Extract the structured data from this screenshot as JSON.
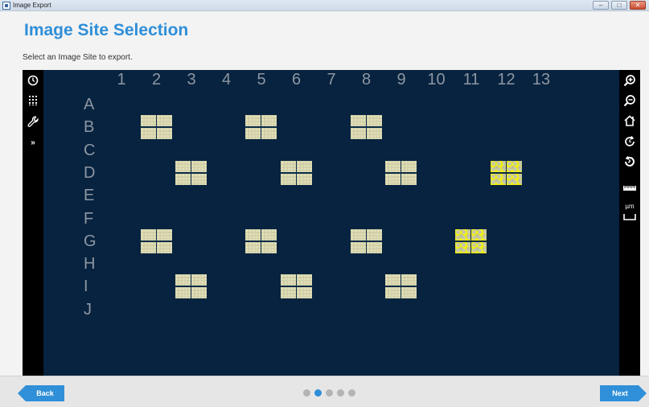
{
  "window": {
    "title": "Image Export",
    "controls": {
      "minimize": "–",
      "restore": "□",
      "close": "✕"
    }
  },
  "header": {
    "title": "Image Site Selection",
    "instruction": "Select an Image Site to export."
  },
  "grid": {
    "columns": [
      "1",
      "2",
      "3",
      "4",
      "5",
      "6",
      "7",
      "8",
      "9",
      "10",
      "11",
      "12",
      "13"
    ],
    "rows": [
      "A",
      "B",
      "C",
      "D",
      "E",
      "F",
      "G",
      "H",
      "I",
      "J"
    ],
    "sites": [
      {
        "well": "B2",
        "selected": false
      },
      {
        "well": "B5",
        "selected": false
      },
      {
        "well": "B8",
        "selected": false
      },
      {
        "well": "D3",
        "selected": false
      },
      {
        "well": "D6",
        "selected": false
      },
      {
        "well": "D9",
        "selected": false
      },
      {
        "well": "D12",
        "selected": true
      },
      {
        "well": "G2",
        "selected": false
      },
      {
        "well": "G5",
        "selected": false
      },
      {
        "well": "G8",
        "selected": false
      },
      {
        "well": "G11",
        "selected": true
      },
      {
        "well": "I3",
        "selected": false
      },
      {
        "well": "I6",
        "selected": false
      },
      {
        "well": "I9",
        "selected": false
      }
    ]
  },
  "left_toolbar": [
    "clock-icon",
    "column-grid-icon",
    "wrench-icon",
    "double-chevron-right-icon"
  ],
  "right_toolbar": [
    "zoom-in-icon",
    "zoom-out-icon",
    "home-icon",
    "rotate-clockwise-icon",
    "rotate-counterclockwise-icon",
    "ruler-icon",
    "scale-bar-icon"
  ],
  "right_toolbar_labels": {
    "scale_unit": "µm"
  },
  "navigation": {
    "back_label": "Back",
    "next_label": "Next",
    "page_count": 5,
    "current_page": 2
  },
  "colors": {
    "accent": "#2f8fd8",
    "viewer_background": "#07233f",
    "selected_site": "#f2f20a"
  }
}
